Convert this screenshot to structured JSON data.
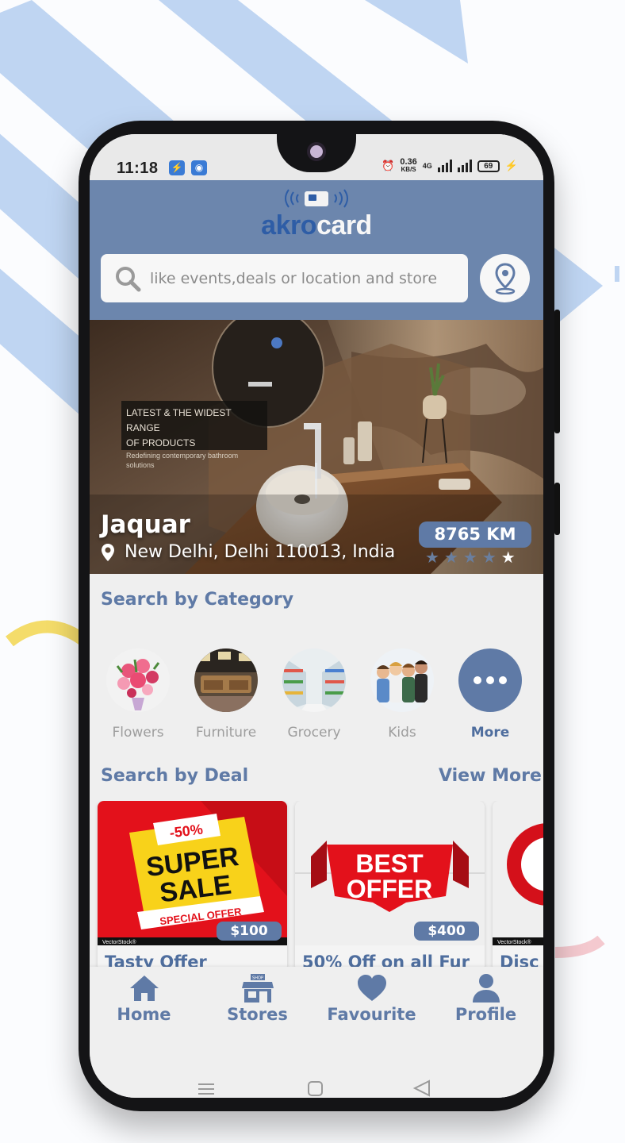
{
  "status_bar": {
    "time": "11:18",
    "net_speed": "0.36",
    "net_unit": "KB/S",
    "network": "4G",
    "battery": "69"
  },
  "brand": {
    "logo_part1": "akro",
    "logo_part2": "card",
    "color_primary": "#6c86ad",
    "color_accent": "#5f7aa6"
  },
  "search": {
    "placeholder": "like events,deals or location and store"
  },
  "featured": {
    "promo_line1": "LATEST & THE WIDEST RANGE",
    "promo_line2": "OF PRODUCTS",
    "promo_line3": "Redefining contemporary bathroom solutions",
    "store_name": "Jaquar",
    "location": "New Delhi, Delhi 110013, India",
    "distance": "8765 KM",
    "rating": 1,
    "rating_max": 5
  },
  "categories": {
    "title": "Search by Category",
    "items": [
      {
        "label": "Flowers",
        "icon": "flowers-image"
      },
      {
        "label": "Furniture",
        "icon": "furniture-image"
      },
      {
        "label": "Grocery",
        "icon": "grocery-image"
      },
      {
        "label": "Kids",
        "icon": "kids-image"
      },
      {
        "label": "More",
        "icon": "more-icon"
      }
    ]
  },
  "deals": {
    "title": "Search by Deal",
    "view_more": "View More",
    "items": [
      {
        "price": "$100",
        "title": "Tasty Offer",
        "badge_top": "-50%",
        "badge_mid1": "SUPER",
        "badge_mid2": "SALE",
        "badge_bottom": "SPECIAL OFFER",
        "watermark": "VectorStock®"
      },
      {
        "price": "$400",
        "title": "50% Off on all Fur",
        "badge_mid1": "BEST",
        "badge_mid2": "OFFER",
        "watermark": "VectorStock®"
      },
      {
        "title": "Disc",
        "watermark": "VectorStock®"
      }
    ]
  },
  "nav": {
    "items": [
      {
        "label": "Home",
        "icon": "home-icon"
      },
      {
        "label": "Stores",
        "icon": "store-icon",
        "sign": "SHOP"
      },
      {
        "label": "Favourite",
        "icon": "heart-icon"
      },
      {
        "label": "Profile",
        "icon": "user-icon"
      }
    ]
  }
}
